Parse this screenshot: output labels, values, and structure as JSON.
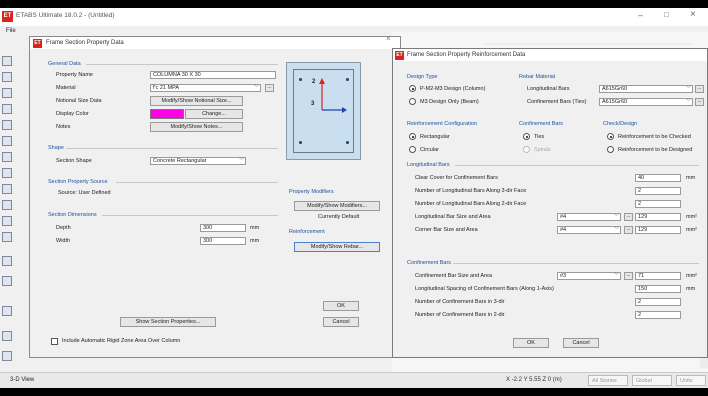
{
  "app": {
    "title": "ETABS Ultimate 18.0.2 - (Untitled)",
    "logo_text": "ET",
    "menu_file": "File",
    "window_buttons": {
      "minimize": "–",
      "maximize": "□",
      "close": "×"
    },
    "status": {
      "view": "3-D View",
      "coords": "X -2.2  Y 5.55  Z 0 (m)",
      "stories": "All Stories",
      "global": "Global",
      "units": "Units"
    }
  },
  "section_dialog": {
    "title": "Frame Section Property Data",
    "close": "×",
    "general": {
      "group": "General Data",
      "property_name_label": "Property Name",
      "property_name": "COLUMNA 30 X 30",
      "material_label": "Material",
      "material": "f'c 21 MPA",
      "notional_label": "Notional Size Data",
      "notional_button": "Modify/Show Notional Size...",
      "display_color_label": "Display Color",
      "display_color": "#ff00e6",
      "change_button": "Change...",
      "notes_label": "Notes",
      "notes_button": "Modify/Show Notes..."
    },
    "shape": {
      "group": "Shape",
      "label": "Section Shape",
      "value": "Concrete Rectangular"
    },
    "source": {
      "group": "Section Property Source",
      "text": "Source:  User Defined"
    },
    "dimensions": {
      "group": "Section Dimensions",
      "depth_label": "Depth",
      "depth": "300",
      "width_label": "Width",
      "width": "300",
      "unit": "mm"
    },
    "preview": {
      "axis2": "2",
      "axis3": "3"
    },
    "property_modifiers": {
      "group": "Property Modifiers",
      "button": "Modify/Show Modifiers...",
      "text": "Currently Default"
    },
    "reinforcement": {
      "group": "Reinforcement",
      "button": "Modify/Show Rebar..."
    },
    "show_props_button": "Show Section Properties...",
    "ok": "OK",
    "cancel": "Cancel",
    "rigid_zone_label": "Include Automatic Rigid Zone Area Over Column"
  },
  "rebar_dialog": {
    "title": "Frame Section Property Reinforcement Data",
    "design_type": {
      "group": "Design Type",
      "opt1": "P-M2-M3 Design (Column)",
      "opt2": "M3 Design Only (Beam)"
    },
    "rebar_material": {
      "group": "Rebar Material",
      "long_label": "Longitudinal Bars",
      "long_value": "A615Gr60",
      "conf_label": "Confinement Bars (Ties)",
      "conf_value": "A615Gr60"
    },
    "configuration": {
      "group": "Reinforcement Configuration",
      "opt1": "Rectangular",
      "opt2": "Circular"
    },
    "confinement_bars": {
      "group": "Confinement Bars",
      "opt1": "Ties",
      "opt2": "Spirals"
    },
    "check_design": {
      "group": "Check/Design",
      "opt1": "Reinforcement to be Checked",
      "opt2": "Reinforcement to be Designed"
    },
    "longitudinal": {
      "group": "Longitudinal Bars",
      "cover_label": "Clear Cover for Confinement Bars",
      "cover": "40",
      "cover_unit": "mm",
      "n3_label": "Number of Longitudinal Bars Along 3-dir Face",
      "n3": "2",
      "n2_label": "Number of Longitudinal Bars Along 2-dir Face",
      "n2": "2",
      "bar_label": "Longitudinal Bar Size and Area",
      "bar_size": "#4",
      "bar_area": "129",
      "corner_label": "Corner Bar Size and Area",
      "corner_size": "#4",
      "corner_area": "129",
      "area_unit": "mm²"
    },
    "confinement": {
      "group": "Confinement Bars",
      "size_label": "Confinement Bar Size and Area",
      "size": "#3",
      "area": "71",
      "area_unit": "mm²",
      "spacing_label": "Longitudinal Spacing of Confinement Bars  (Along 1-Axis)",
      "spacing": "150",
      "spacing_unit": "mm",
      "n3_label": "Number of Confinement Bars in 3-dir",
      "n3": "2",
      "n2_label": "Number of Confinement Bars in 2-dir",
      "n2": "2"
    },
    "ok": "OK",
    "cancel": "Cancel"
  },
  "colors": {
    "group_title": "#1c4f9c",
    "logo": "#d9261c",
    "preview_bg": "#c9dff0"
  }
}
